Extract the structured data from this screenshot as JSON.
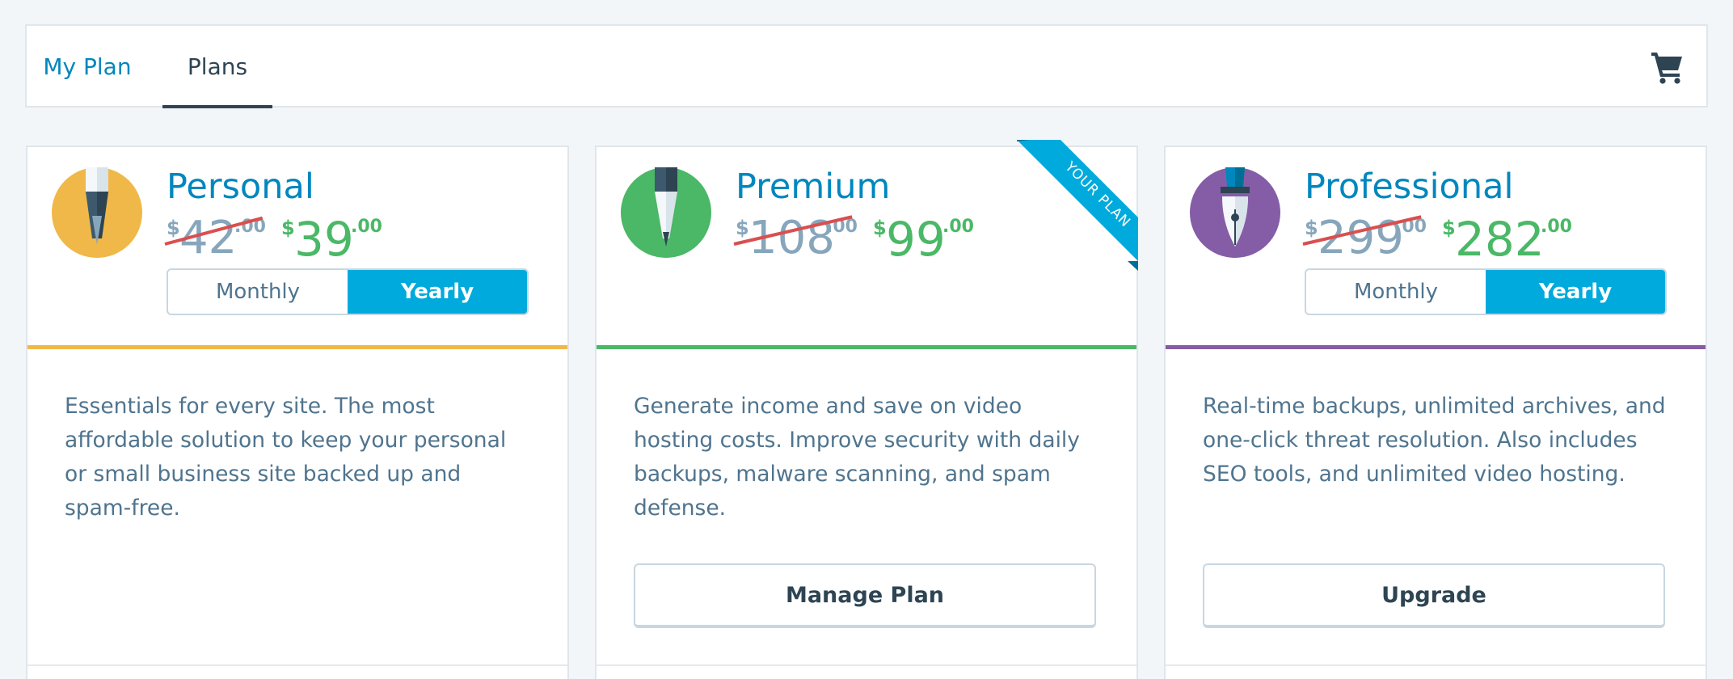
{
  "nav": {
    "tabs": [
      {
        "label": "My Plan",
        "active": false
      },
      {
        "label": "Plans",
        "active": true
      }
    ],
    "cart_icon": "cart-icon"
  },
  "colors": {
    "link": "#0087be",
    "price_new": "#4ab866",
    "price_old": "#87a6bc",
    "strike": "#d94f4f",
    "toggle_active": "#00aadc",
    "personal_accent": "#f0b849",
    "premium_accent": "#4ab866",
    "professional_accent": "#855da6"
  },
  "plans": [
    {
      "name": "Personal",
      "icon": "pencil-icon",
      "old_price": {
        "symbol": "$",
        "int": "42",
        "dec": ".00"
      },
      "new_price": {
        "symbol": "$",
        "int": "39",
        "dec": ".00"
      },
      "toggle": {
        "monthly": "Monthly",
        "yearly": "Yearly",
        "selected": "Yearly"
      },
      "description": "Essentials for every site. The most affordable solution to keep your personal or small business site backed up and spam-free."
    },
    {
      "name": "Premium",
      "icon": "pen-icon",
      "old_price": {
        "symbol": "$",
        "int": "108",
        "dec": ".00"
      },
      "new_price": {
        "symbol": "$",
        "int": "99",
        "dec": ".00"
      },
      "ribbon": "YOUR PLAN",
      "description": "Generate income and save on video hosting costs. Improve security with daily backups, malware scanning, and spam defense.",
      "button": "Manage Plan"
    },
    {
      "name": "Professional",
      "icon": "fountain-pen-icon",
      "old_price": {
        "symbol": "$",
        "int": "299",
        "dec": ".00"
      },
      "new_price": {
        "symbol": "$",
        "int": "282",
        "dec": ".00"
      },
      "toggle": {
        "monthly": "Monthly",
        "yearly": "Yearly",
        "selected": "Yearly"
      },
      "description": "Real-time backups, unlimited archives, and one-click threat resolution. Also includes SEO tools, and unlimited video hosting.",
      "button": "Upgrade"
    }
  ]
}
